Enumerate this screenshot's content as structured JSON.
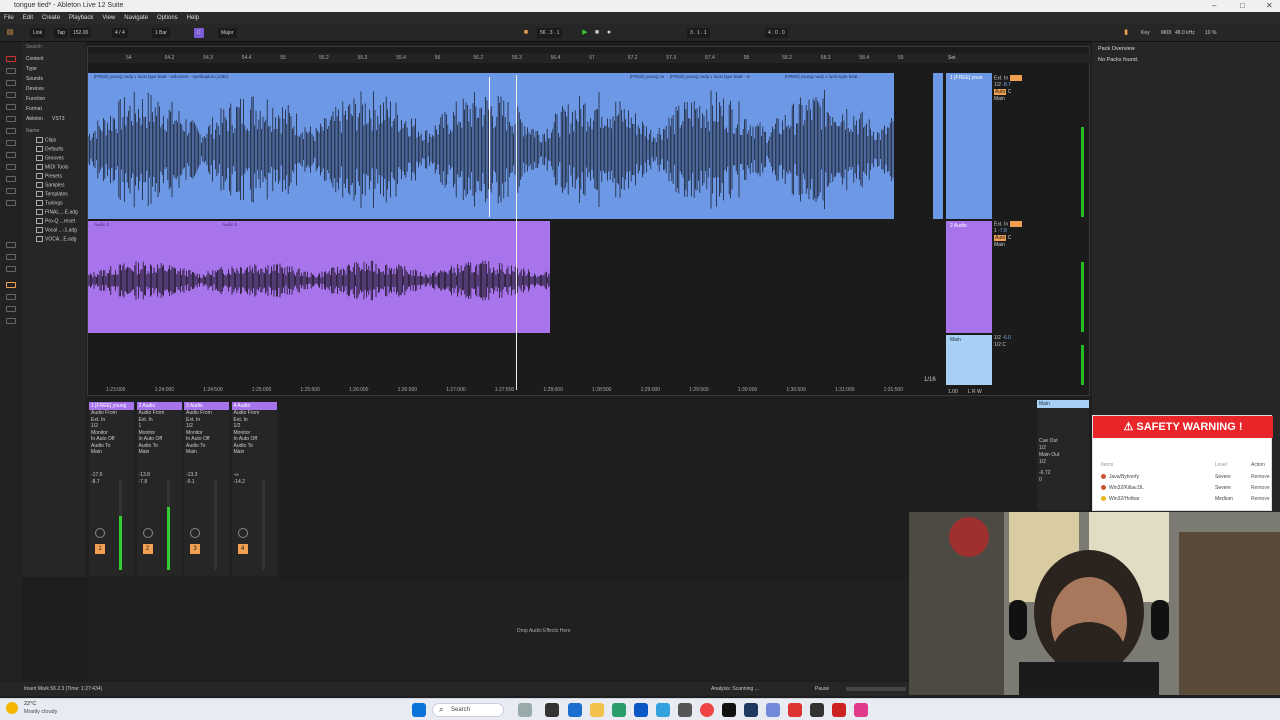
{
  "window": {
    "title": "tongue tied* - Ableton Live 12 Suite"
  },
  "menu": [
    "File",
    "Edit",
    "Create",
    "Playback",
    "View",
    "Navigate",
    "Options",
    "Help"
  ],
  "transport": {
    "link": "Link",
    "tap": "Tap",
    "tempo": "152.00",
    "signature": "4 / 4",
    "quantize": "1 Bar",
    "key": "C",
    "scale": "Major",
    "position": "56 . 3 . 1",
    "loop_start": "3 . 1 . 1",
    "loop_length": "4 . 0 . 0",
    "key_label": "Key",
    "midi_label": "MIDI",
    "sample_rate": "48.0 kHz",
    "cpu": "10 %"
  },
  "colors": {
    "track_blue": "#6d98e6",
    "track_purple": "#a874ec",
    "main_blue": "#a8d0f4",
    "warning_red": "#e8262a",
    "accent_orange": "#f0a050"
  },
  "browser": {
    "search_placeholder": "Search",
    "categories": [
      "Content",
      "Type",
      "Sounds",
      "Devices",
      "Function",
      "Format",
      "Ableton",
      "VST3",
      "Name"
    ],
    "items": [
      "Clips",
      "Defaults",
      "Grooves",
      "MIDI Tools",
      "Presets",
      "Samples",
      "Templates",
      "Tunings",
      "FINAL....E.adg",
      "Pro-Q ...reset",
      "Vocal ...-1.adg",
      "VOCA...E.adg"
    ]
  },
  "arrangement": {
    "ruler": [
      "54",
      "54.2",
      "54.3",
      "54.4",
      "55",
      "55.2",
      "55.3",
      "55.4",
      "56",
      "56.2",
      "56.3",
      "56.4",
      "57",
      "57.2",
      "57.3",
      "57.4",
      "58",
      "58.2",
      "58.3",
      "58.4",
      "59"
    ],
    "set_label": "Set",
    "track1_clip": "[FREE] young nudy x lucki type beat - wthosem - synthaplus (128k)",
    "track1_clip2": "[FREE] young nu",
    "track1_clip3": "[FREE] young nudy x lucki type beat - w",
    "track1_clip4": "[FREE] young nudy x lucki type beat -",
    "track2_clip1": "Audio 2",
    "track2_clip2": "Audio 5",
    "time_ticks": [
      "1:23:000",
      "1:24:000",
      "1:24:500",
      "1:25:000",
      "1:25:500",
      "1:26:000",
      "1:26:500",
      "1:27:000",
      "1:27:500",
      "1:28:000",
      "1:28:500",
      "1:29:000",
      "1:29:500",
      "1:30:000",
      "1:30:500",
      "1:31:000",
      "1:31:500"
    ],
    "grid": "1/16",
    "zoom": "1.00",
    "zoom_unit": "L R W"
  },
  "tracks": [
    {
      "name": "1 [FREE] youn",
      "in": "Ext. In",
      "ch": "1/2",
      "mon": "Auto",
      "out": "Main",
      "vol": "-8.7",
      "pan": "C"
    },
    {
      "name": "2 Audio",
      "in": "Ext. In",
      "ch": "1",
      "mon": "Auto",
      "out": "Main",
      "vol": "-7.8",
      "pan": "C"
    },
    {
      "name": "Main",
      "in": "",
      "ch": "1/2",
      "mon": "",
      "out": "1/2",
      "vol": "-6.0",
      "pan": "C"
    }
  ],
  "mixer": {
    "strips": [
      {
        "name": "1 [FREE] young",
        "num": "1",
        "vol": "-17.6",
        "peak": "-8.7",
        "level": 0.6
      },
      {
        "name": "2 Audio",
        "num": "2",
        "vol": "-13.8",
        "peak": "-7.8",
        "level": 0.7
      },
      {
        "name": "3 Audio",
        "num": "3",
        "vol": "-13.3",
        "peak": "-9.1",
        "level": 0
      },
      {
        "name": "4 Audio",
        "num": "4",
        "vol": "-∞",
        "peak": "-14.2",
        "level": 0
      }
    ],
    "audio_from": "Audio From",
    "ext_in": "Ext. In",
    "monitor": "Monitor",
    "in_auto_off": "In Auto Off",
    "audio_to": "Audio To",
    "main": "Main",
    "main_strip": {
      "name": "Main",
      "cue_out": "Cue Out",
      "cue_ch": "1/2",
      "main_out": "Main Out",
      "main_ch": "1/2",
      "vol": "-6.72",
      "peak": "0"
    }
  },
  "right_panel": {
    "title": "Pack Overview",
    "empty": "No Packs found."
  },
  "drop_zone": "Drop Audio Effects Here",
  "status": {
    "left": "Insert Mark 56.2.3 (Time: 1:27:434)",
    "right": "Analysis: Scanning ...",
    "pause": "Pause"
  },
  "warning": {
    "title": "SAFETY WARNING !",
    "col_name": "Items",
    "col_level": "Level",
    "col_action": "Action",
    "rows": [
      {
        "name": "Java/Bytvorfy",
        "level": "Severe",
        "action": "Remove"
      },
      {
        "name": "Win32/Killav.DL",
        "level": "Severe",
        "action": "Remove"
      },
      {
        "name": "Win32/Hotbar",
        "level": "Medium",
        "action": "Remove"
      }
    ]
  },
  "taskbar": {
    "weather_temp": "22°C",
    "weather_desc": "Mostly cloudy",
    "search": "Search"
  }
}
